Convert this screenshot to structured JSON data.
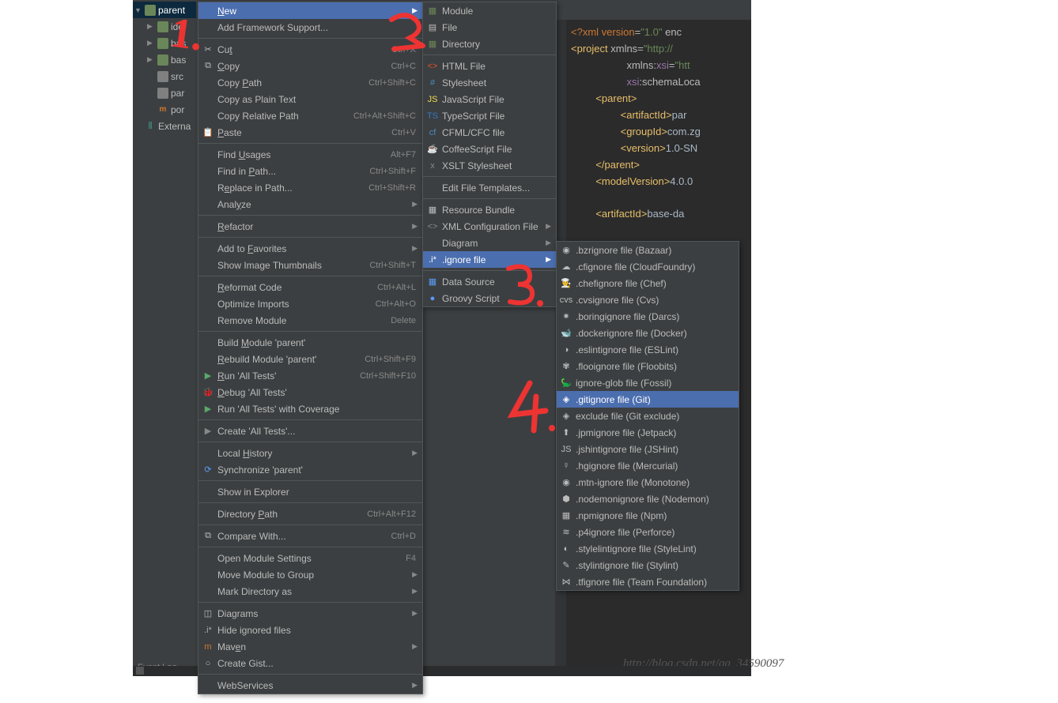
{
  "tree": {
    "root": "parent",
    "items": [
      {
        "label": "ide",
        "icon": "folder"
      },
      {
        "label": "bas",
        "icon": "folder"
      },
      {
        "label": "bas",
        "icon": "folder"
      },
      {
        "label": "src",
        "icon": "folder2"
      },
      {
        "label": "par",
        "icon": "folder2"
      },
      {
        "label": "por",
        "icon": "m"
      },
      {
        "label": "Externa",
        "icon": "bars"
      }
    ]
  },
  "event_log": "Event Log",
  "watermark": "http://blog.csdn.net/qq_34590097",
  "xml": {
    "l1_a": "<?",
    "l1_b": "xml version",
    "l1_c": "=",
    "l1_d": "\"1.0\"",
    "l1_e": " enc",
    "l2_a": "<",
    "l2_b": "project ",
    "l2_c": "xmlns",
    "l2_d": "=",
    "l2_e": "\"http://",
    "l3_a": "xmlns:",
    "l3_b": "xsi",
    "l3_c": "=",
    "l3_d": "\"htt",
    "l4_a": "xsi",
    "l4_b": ":schemaLoca",
    "l5_a": "<",
    "l5_b": "parent",
    "l5_c": ">",
    "l6_a": "<",
    "l6_b": "artifactId",
    "l6_c": ">",
    "l6_d": "par",
    "l7_a": "<",
    "l7_b": "groupId",
    "l7_c": ">",
    "l7_d": "com.zg",
    "l8_a": "<",
    "l8_b": "version",
    "l8_c": ">",
    "l8_d": "1.0-SN",
    "l9_a": "</",
    "l9_b": "parent",
    "l9_c": ">",
    "l10_a": "<",
    "l10_b": "modelVersion",
    "l10_c": ">",
    "l10_d": "4.0.0",
    "l12_a": "<",
    "l12_b": "artifactId",
    "l12_c": ">",
    "l12_d": "base-da"
  },
  "menu1": [
    {
      "label": "New",
      "sub": true,
      "hi": true
    },
    {
      "label": "Add Framework Support..."
    },
    {
      "sep": true
    },
    {
      "label": "Cut",
      "sc": "Ctrl+X",
      "icon": "✂"
    },
    {
      "label": "Copy",
      "sc": "Ctrl+C",
      "icon": "⧉"
    },
    {
      "label": "Copy Path",
      "sc": "Ctrl+Shift+C"
    },
    {
      "label": "Copy as Plain Text"
    },
    {
      "label": "Copy Relative Path",
      "sc": "Ctrl+Alt+Shift+C"
    },
    {
      "label": "Paste",
      "sc": "Ctrl+V",
      "icon": "📋"
    },
    {
      "sep": true
    },
    {
      "label": "Find Usages",
      "sc": "Alt+F7"
    },
    {
      "label": "Find in Path...",
      "sc": "Ctrl+Shift+F"
    },
    {
      "label": "Replace in Path...",
      "sc": "Ctrl+Shift+R"
    },
    {
      "label": "Analyze",
      "sub": true
    },
    {
      "sep": true
    },
    {
      "label": "Refactor",
      "sub": true
    },
    {
      "sep": true
    },
    {
      "label": "Add to Favorites",
      "sub": true
    },
    {
      "label": "Show Image Thumbnails",
      "sc": "Ctrl+Shift+T"
    },
    {
      "sep": true
    },
    {
      "label": "Reformat Code",
      "sc": "Ctrl+Alt+L"
    },
    {
      "label": "Optimize Imports",
      "sc": "Ctrl+Alt+O"
    },
    {
      "label": "Remove Module",
      "sc": "Delete"
    },
    {
      "sep": true
    },
    {
      "label": "Build Module 'parent'"
    },
    {
      "label": "Rebuild Module 'parent'",
      "sc": "Ctrl+Shift+F9"
    },
    {
      "label": "Run 'All Tests'",
      "sc": "Ctrl+Shift+F10",
      "icon": "▶",
      "iconColor": "#59a869"
    },
    {
      "label": "Debug 'All Tests'",
      "icon": "🐞",
      "iconColor": "#59a869"
    },
    {
      "label": "Run 'All Tests' with Coverage",
      "icon": "▶",
      "iconColor": "#59a869"
    },
    {
      "sep": true
    },
    {
      "label": "Create 'All Tests'...",
      "icon": "▶",
      "iconColor": "#888"
    },
    {
      "sep": true
    },
    {
      "label": "Local History",
      "sub": true
    },
    {
      "label": "Synchronize 'parent'",
      "icon": "⟳",
      "iconColor": "#589df6"
    },
    {
      "sep": true
    },
    {
      "label": "Show in Explorer"
    },
    {
      "sep": true
    },
    {
      "label": "Directory Path",
      "sc": "Ctrl+Alt+F12"
    },
    {
      "sep": true
    },
    {
      "label": "Compare With...",
      "sc": "Ctrl+D",
      "icon": "⧉"
    },
    {
      "sep": true
    },
    {
      "label": "Open Module Settings",
      "sc": "F4"
    },
    {
      "label": "Move Module to Group",
      "sub": true
    },
    {
      "label": "Mark Directory as",
      "sub": true
    },
    {
      "sep": true
    },
    {
      "label": "Diagrams",
      "sub": true,
      "icon": "◫"
    },
    {
      "label": "Hide ignored files",
      "icon": ".i*",
      "iconColor": "#aaa"
    },
    {
      "label": "Maven",
      "sub": true,
      "icon": "m",
      "iconColor": "#cc7832"
    },
    {
      "label": "Create Gist...",
      "icon": "○"
    },
    {
      "sep": true
    },
    {
      "label": "WebServices",
      "sub": true
    }
  ],
  "menu2": [
    {
      "label": "Module",
      "icon": "▦",
      "iconColor": "#6a8759"
    },
    {
      "label": "File",
      "icon": "▤"
    },
    {
      "label": "Directory",
      "icon": "▦",
      "iconColor": "#6a8759"
    },
    {
      "sep": true
    },
    {
      "label": "HTML File",
      "icon": "<>",
      "iconColor": "#e44d26"
    },
    {
      "label": "Stylesheet",
      "icon": "#",
      "iconColor": "#4b8bbe"
    },
    {
      "label": "JavaScript File",
      "icon": "JS",
      "iconColor": "#f0db4f"
    },
    {
      "label": "TypeScript File",
      "icon": "TS",
      "iconColor": "#3178c6"
    },
    {
      "label": "CFML/CFC file",
      "icon": "cf",
      "iconColor": "#4b8bbe"
    },
    {
      "label": "CoffeeScript File",
      "icon": "☕"
    },
    {
      "label": "XSLT Stylesheet",
      "icon": "x",
      "iconColor": "#888"
    },
    {
      "sep": true
    },
    {
      "label": "Edit File Templates..."
    },
    {
      "sep": true
    },
    {
      "label": "Resource Bundle",
      "icon": "▦"
    },
    {
      "label": "XML Configuration File",
      "sub": true,
      "icon": "<>",
      "iconColor": "#888"
    },
    {
      "label": "Diagram",
      "sub": true
    },
    {
      "label": ".ignore file",
      "sub": true,
      "hi": true,
      "icon": ".i*"
    },
    {
      "sep": true
    },
    {
      "label": "Data Source",
      "icon": "▦",
      "iconColor": "#589df6"
    },
    {
      "label": "Groovy Script",
      "icon": "●",
      "iconColor": "#589df6"
    }
  ],
  "menu3": [
    {
      "label": ".bzrignore file (Bazaar)",
      "icon": "◉"
    },
    {
      "label": ".cfignore file (CloudFoundry)",
      "icon": "☁"
    },
    {
      "label": ".chefignore file (Chef)",
      "icon": "👨‍🍳"
    },
    {
      "label": ".cvsignore file (Cvs)",
      "icon": "cvs"
    },
    {
      "label": ".boringignore file (Darcs)",
      "icon": "✷"
    },
    {
      "label": ".dockerignore file (Docker)",
      "icon": "🐋"
    },
    {
      "label": ".eslintignore file (ESLint)",
      "icon": "◑"
    },
    {
      "label": ".flooignore file (Floobits)",
      "icon": "✾"
    },
    {
      "label": "ignore-glob file (Fossil)",
      "icon": "🦕"
    },
    {
      "label": ".gitignore file (Git)",
      "icon": "◈",
      "hi": true
    },
    {
      "label": "exclude file (Git exclude)",
      "icon": "◈"
    },
    {
      "label": ".jpmignore file (Jetpack)",
      "icon": "⬆"
    },
    {
      "label": ".jshintignore file (JSHint)",
      "icon": "JS"
    },
    {
      "label": ".hgignore file (Mercurial)",
      "icon": "☿"
    },
    {
      "label": ".mtn-ignore file (Monotone)",
      "icon": "◉"
    },
    {
      "label": ".nodemonignore file (Nodemon)",
      "icon": "⬢"
    },
    {
      "label": ".npmignore file (Npm)",
      "icon": "▦"
    },
    {
      "label": ".p4ignore file (Perforce)",
      "icon": "≋"
    },
    {
      "label": ".stylelintignore file (StyleLint)",
      "icon": "◐"
    },
    {
      "label": ".stylintignore file (Stylint)",
      "icon": "✎"
    },
    {
      "label": ".tfignore file (Team Foundation)",
      "icon": "⋈"
    }
  ],
  "annotations": {
    "a1": "1.",
    "a2": "2.",
    "a3": "3.",
    "a4": "4."
  }
}
